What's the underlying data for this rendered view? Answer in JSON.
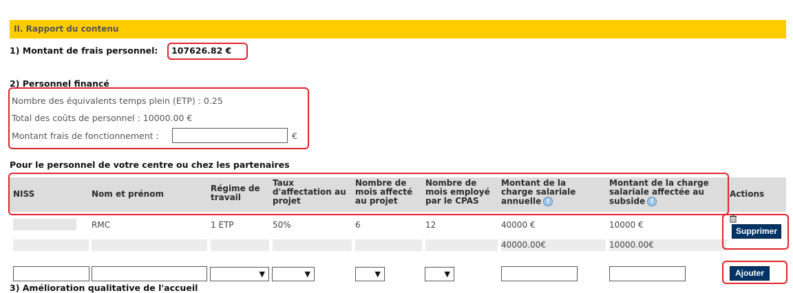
{
  "section": {
    "title": "II. Rapport du contenu"
  },
  "montant": {
    "label": "1) Montant de frais personnel",
    "value": "107626.82 €"
  },
  "personnel": {
    "title": "2) Personnel financé",
    "etp": "Nombre des équivalents temps plein (ETP) : 0.25",
    "total": "Total des coûts de personnel : 10000.00 €",
    "fonctionnement_label": "Montant frais de fonctionnement :",
    "fonctionnement_value": "",
    "currency": "€"
  },
  "table": {
    "caption": "Pour le personnel de votre centre ou chez les partenaires",
    "headers": {
      "niss": "NISS",
      "nom": "Nom et prénom",
      "regime_1": "Régime de",
      "regime_2": "travail",
      "taux_1": "Taux",
      "taux_2": "d'affectation au",
      "taux_3": "projet",
      "mois_aff_1": "Nombre de",
      "mois_aff_2": "mois affecté",
      "mois_aff_3": "au projet",
      "mois_emp_1": "Nombre de",
      "mois_emp_2": "mois employé",
      "mois_emp_3": "par le CPAS",
      "charge_1": "Montant de la",
      "charge_2": "charge salariale",
      "charge_3": "annuelle",
      "subside_1": "Montant de la charge",
      "subside_2": "salariale affectée au",
      "subside_3": "subside",
      "actions": "Actions"
    },
    "row": {
      "nom": "RMC",
      "regime": "1 ETP",
      "taux": "50%",
      "mois_affecte": "6",
      "mois_employe": "12",
      "charge": "40000 €",
      "subside": "10000 €"
    },
    "totals": {
      "charge": "40000.00€",
      "subside": "10000.00€"
    },
    "buttons": {
      "delete": "Supprimer",
      "add": "Ajouter"
    }
  },
  "next_section": {
    "title": "3) Amélioration qualitative de l'accueil"
  },
  "icons": {
    "info": "info-icon",
    "trash": "trash-icon"
  },
  "colors": {
    "header": "#ffcc00",
    "button": "#003366",
    "highlight": "#e0202a"
  }
}
